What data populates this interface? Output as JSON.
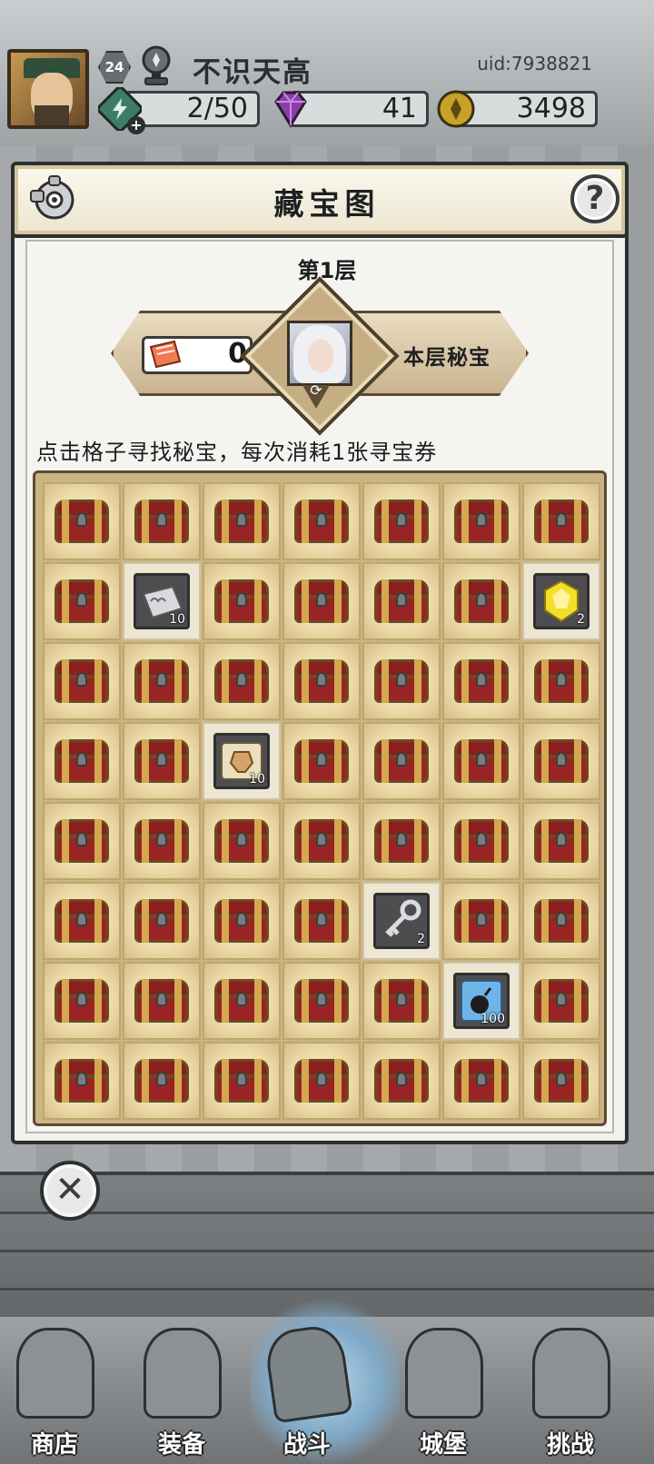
{
  "header": {
    "level": "24",
    "player_name": "不识天高",
    "uid": "uid:7938821",
    "energy": "2/50",
    "gems": "41",
    "gold": "3498",
    "colors": {
      "energy": "#3d7d68",
      "gems": "#8a3fa8",
      "gold": "#c7a227"
    }
  },
  "dialog": {
    "title": "藏宝图",
    "help_label": "?",
    "floor_label": "第1层",
    "ticket_count": "0",
    "secret_label": "本层秘宝",
    "instruction": "点击格子寻找秘宝，每次消耗1张寻宝券",
    "close_label": "✕"
  },
  "grid": {
    "rows": 8,
    "cols": 7,
    "revealed": [
      {
        "row": 1,
        "col": 1,
        "item": "silver-ingot-icon",
        "qty": "10"
      },
      {
        "row": 1,
        "col": 6,
        "item": "gold-gem-icon",
        "qty": "2"
      },
      {
        "row": 3,
        "col": 2,
        "item": "scroll-icon",
        "qty": "10"
      },
      {
        "row": 5,
        "col": 4,
        "item": "key-icon",
        "qty": "2"
      },
      {
        "row": 6,
        "col": 5,
        "item": "bomb-icon",
        "qty": "100"
      }
    ]
  },
  "nav": {
    "items": [
      {
        "label": "商店",
        "icon": "shop-icon"
      },
      {
        "label": "装备",
        "icon": "bag-icon"
      },
      {
        "label": "战斗",
        "icon": "swords-icon",
        "active": true
      },
      {
        "label": "城堡",
        "icon": "castle-icon"
      },
      {
        "label": "挑战",
        "icon": "shield-icon"
      }
    ]
  }
}
